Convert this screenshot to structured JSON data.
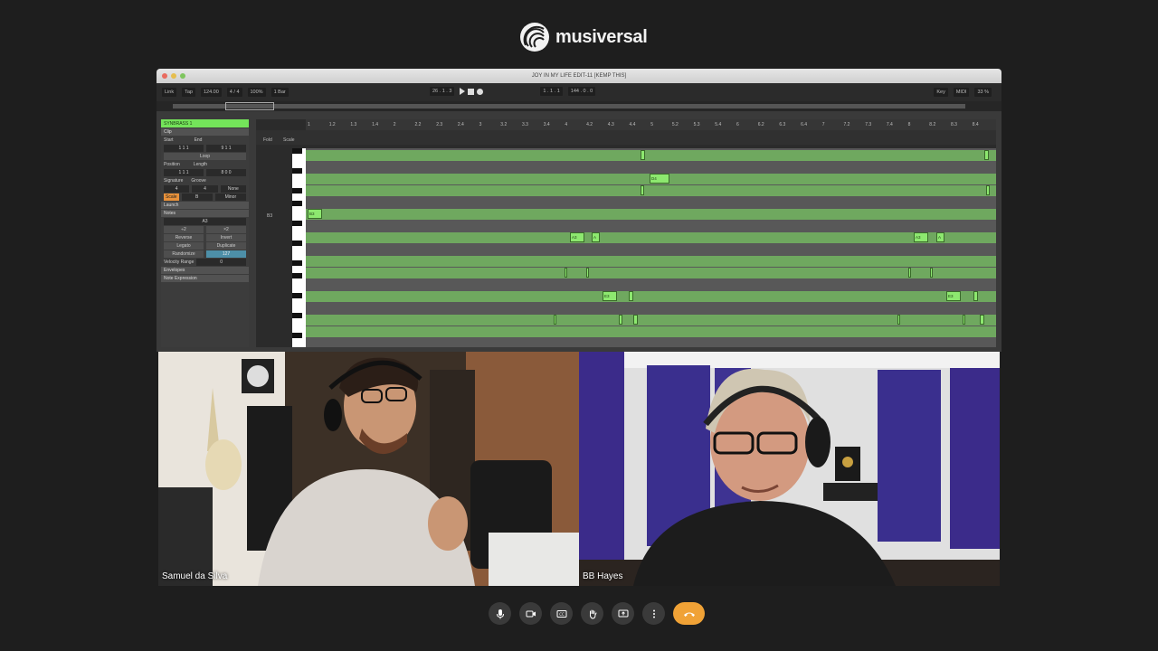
{
  "brand": {
    "name": "musiversal"
  },
  "daw": {
    "window_title": "JOY IN MY LIFE EDIT-11  [KEMP THIS]",
    "transport": {
      "link": "Link",
      "tap": "Tap",
      "tempo": "124.00",
      "signature": "4 / 4",
      "zoom": "100%",
      "quantize": "1 Bar",
      "position": "26 .  1 .  3",
      "loop_start": "1 .  1 .  1",
      "loop_length": "144 .  0 .  0",
      "key": "Key",
      "midi": "MIDI",
      "cpu": "33 %"
    },
    "clip_panel": {
      "track_name": "SYNBRASS 1",
      "clip_header": "Clip",
      "start_label": "Start",
      "end_label": "End",
      "start_value": "1   1   1",
      "end_value": "9   1   1",
      "loop_label": "Loop",
      "position_label": "Position",
      "length_label": "Length",
      "position_value": "1   1   1",
      "length_value": "8   0   0",
      "signature_label": "Signature",
      "groove_label": "Groove",
      "sig_num": "4",
      "sig_den": "4",
      "groove_value": "None",
      "scale_label": "Scale",
      "scale_root": "B",
      "scale_mode": "Minor",
      "launch_header": "Launch",
      "notes_header": "Notes",
      "note_value": "A3",
      "div2": "÷2",
      "mul2": "×2",
      "reverse": "Reverse",
      "invert": "Invert",
      "legato": "Legato",
      "duplicate": "Duplicate",
      "randomize": "Randomize",
      "randomize_value": "127",
      "velocity_range": "Velocity Range",
      "velocity_value": "0",
      "envelopes": "Envelopes",
      "note_expression": "Note Expression"
    },
    "roll": {
      "fold": "Fold",
      "scale": "Scale",
      "key_label": "B3",
      "ruler": [
        "1",
        "1.2",
        "1.3",
        "1.4",
        "2",
        "2.2",
        "2.3",
        "2.4",
        "3",
        "3.2",
        "3.3",
        "3.4",
        "4",
        "4.2",
        "4.3",
        "4.4",
        "5",
        "5.2",
        "5.3",
        "5.4",
        "6",
        "6.2",
        "6.3",
        "6.4",
        "7",
        "7.2",
        "7.3",
        "7.4",
        "8",
        "8.2",
        "8.3",
        "8.4"
      ],
      "notes": [
        {
          "label": "D4"
        },
        {
          "label": "B3"
        },
        {
          "label": "A3"
        },
        {
          "label": "A"
        },
        {
          "label": "A3"
        },
        {
          "label": "A"
        },
        {
          "label": "E3"
        },
        {
          "label": "E3"
        }
      ]
    }
  },
  "participants": [
    {
      "name": "Samuel da Silva"
    },
    {
      "name": "BB Hayes"
    }
  ],
  "controls": [
    "microphone-icon",
    "camera-icon",
    "captions-icon",
    "raise-hand-icon",
    "share-screen-icon",
    "more-icon",
    "end-call-icon"
  ],
  "colors": {
    "accent": "#f0a236",
    "note_green": "#8de86f",
    "lane_green": "#6fa85f"
  }
}
